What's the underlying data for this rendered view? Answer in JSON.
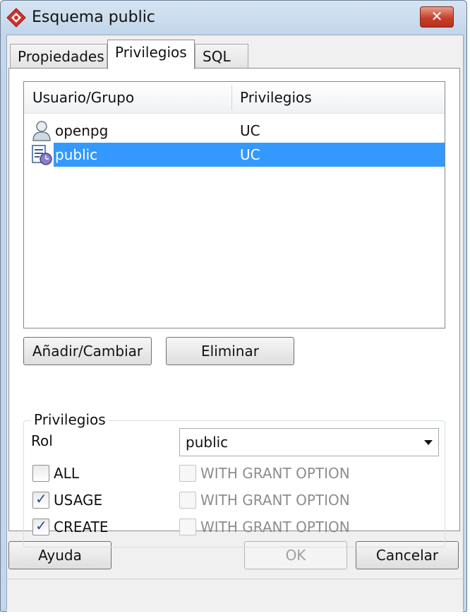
{
  "window": {
    "title": "Esquema public",
    "close_symbol": "✕"
  },
  "tabs": [
    {
      "label": "Propiedades"
    },
    {
      "label": "Privilegios"
    },
    {
      "label": "SQL"
    }
  ],
  "privileges_list": {
    "columns": [
      "Usuario/Grupo",
      "Privilegios"
    ],
    "rows": [
      {
        "icon": "user-icon",
        "name": "openpg",
        "privileges": "UC"
      },
      {
        "icon": "group-icon",
        "name": "public",
        "privileges": "UC",
        "selected": true
      }
    ]
  },
  "buttons": {
    "add_change": "Añadir/Cambiar",
    "delete": "Eliminar",
    "help": "Ayuda",
    "ok": "OK",
    "cancel": "Cancelar"
  },
  "privileges_group": {
    "legend": "Privilegios",
    "role_label": "Rol",
    "role_value": "public",
    "options": [
      {
        "label": "ALL",
        "checked": false,
        "grant_label": "WITH GRANT OPTION",
        "grant_checked": false
      },
      {
        "label": "USAGE",
        "checked": true,
        "grant_label": "WITH GRANT OPTION",
        "grant_checked": false
      },
      {
        "label": "CREATE",
        "checked": true,
        "grant_label": "WITH GRANT OPTION",
        "grant_checked": false
      }
    ]
  },
  "colors": {
    "selection": "#3399ff",
    "title_bar": "#c3d7ea",
    "close_button": "#c7402a"
  }
}
